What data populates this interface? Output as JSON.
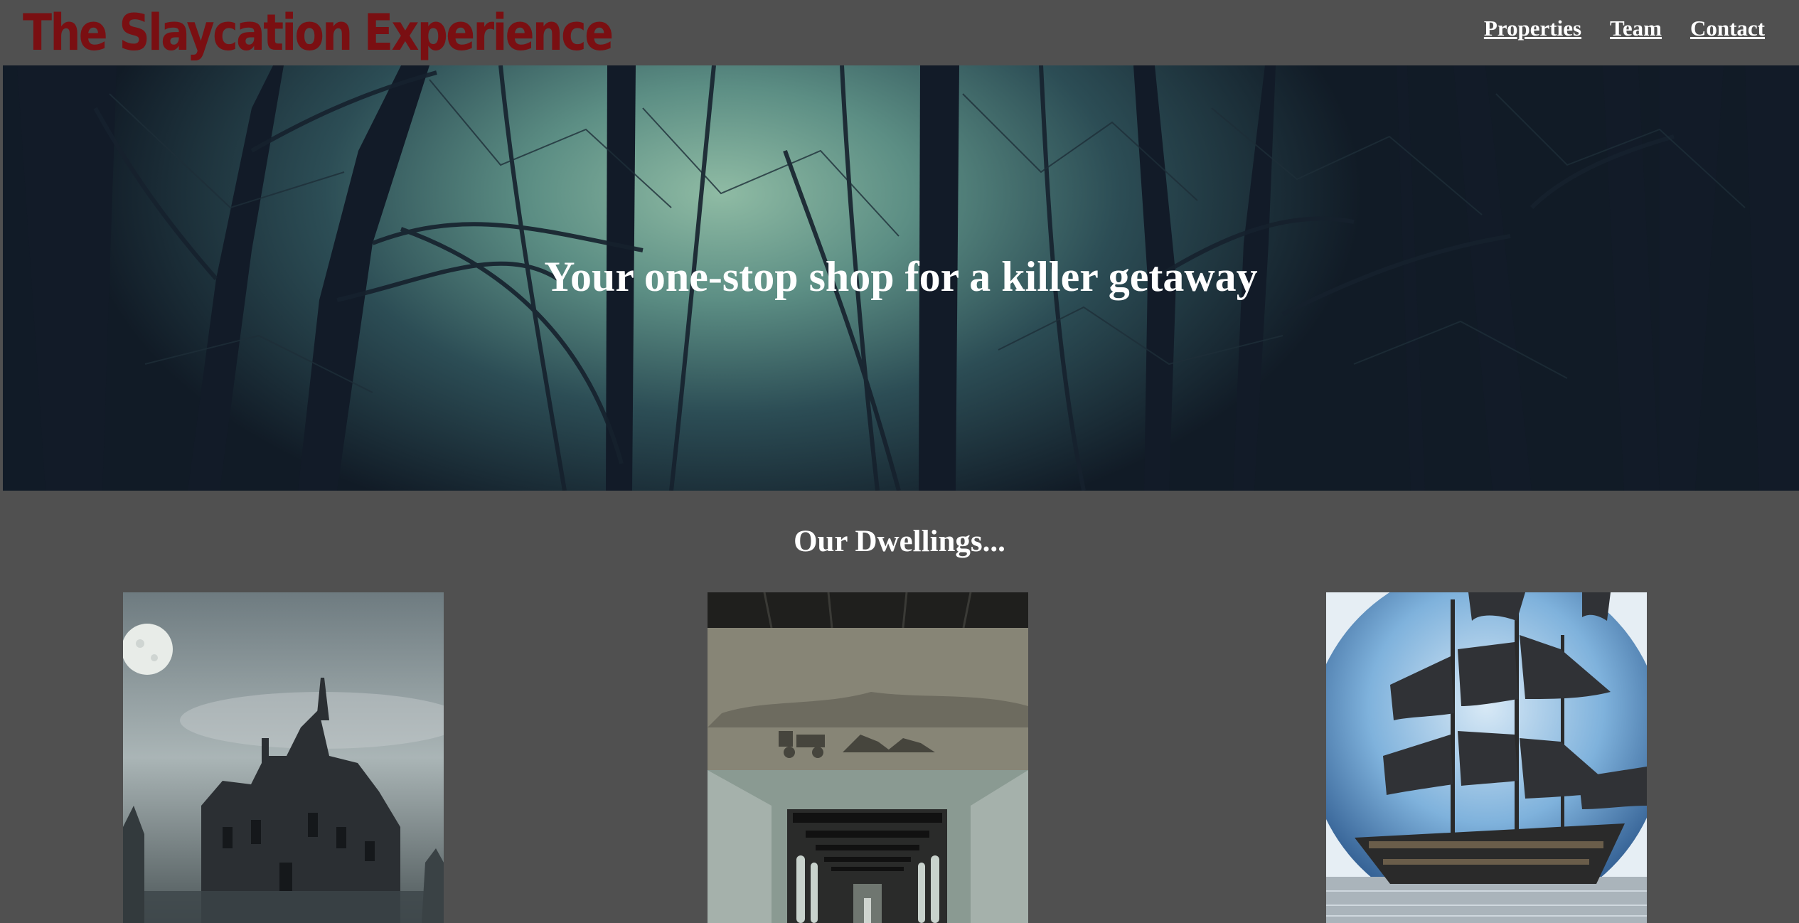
{
  "header": {
    "logo": "The Slaycation Experience",
    "nav": [
      {
        "label": "Properties"
      },
      {
        "label": "Team"
      },
      {
        "label": "Contact"
      }
    ]
  },
  "hero": {
    "tagline": "Your one-stop shop for a killer getaway",
    "image": "dark-foggy-forest"
  },
  "dwellings": {
    "title": "Our Dwellings...",
    "items": [
      {
        "image": "haunted-mansion-moon"
      },
      {
        "image": "abandoned-asylum-corridor"
      },
      {
        "image": "ghost-pirate-ship-moon"
      }
    ]
  },
  "colors": {
    "background": "#505050",
    "logo": "#7a0f12",
    "text": "#ffffff"
  }
}
